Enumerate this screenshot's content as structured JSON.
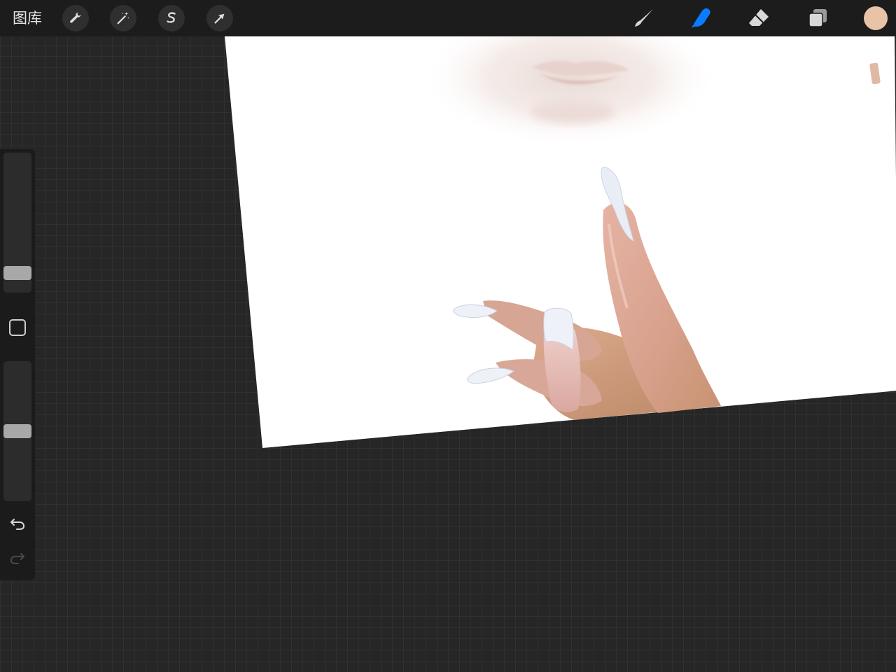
{
  "topbar": {
    "gallery_label": "图库",
    "left_tools": [
      {
        "name": "actions",
        "icon": "wrench-icon"
      },
      {
        "name": "adjustments",
        "icon": "magic-wand-icon"
      },
      {
        "name": "selection",
        "icon": "selection-s-icon"
      },
      {
        "name": "transform",
        "icon": "arrow-cursor-icon"
      }
    ],
    "right_tools": [
      {
        "name": "brush",
        "icon": "brush-icon",
        "active": false
      },
      {
        "name": "smudge",
        "icon": "smudge-finger-icon",
        "active": true
      },
      {
        "name": "eraser",
        "icon": "eraser-icon",
        "active": false
      },
      {
        "name": "layers",
        "icon": "layers-icon",
        "active": false
      }
    ],
    "current_color": "#e8c3a8"
  },
  "colors": {
    "active_tool": "#0a7cff",
    "tool_icon": "#d8d8d8",
    "skin_tone": "#d9a58e",
    "nail_color": "#eef2f8"
  },
  "sidebar": {
    "brush_size_level": 0.1,
    "opacity_level": 0.5,
    "modify_icon": "square-modify-icon",
    "undo_icon": "undo-arrow-icon",
    "redo_icon": "redo-arrow-icon",
    "redo_enabled": false
  }
}
